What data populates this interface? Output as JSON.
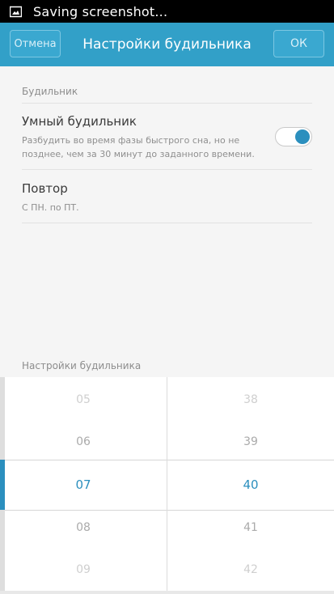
{
  "status_bar": {
    "icon": "image-icon",
    "text": "Saving screenshot..."
  },
  "title_bar": {
    "cancel_label": "Отмена",
    "title": "Настройки будильника",
    "ok_label": "ОК",
    "accent_color": "#32a0c8"
  },
  "settings": {
    "section_header": "Будильник",
    "smart_alarm": {
      "title": "Умный будильник",
      "description": "Разбудить во время фазы быстрого сна, но не позднее, чем за 30 минут до заданного времени.",
      "enabled": true
    },
    "repeat": {
      "title": "Повтор",
      "value": "С ПН. по ПТ."
    }
  },
  "picker": {
    "label": "Настройки будильника",
    "hours": [
      "05",
      "06",
      "07",
      "08",
      "09"
    ],
    "minutes": [
      "38",
      "39",
      "40",
      "41",
      "42"
    ],
    "selected_hour": "07",
    "selected_minute": "40",
    "selection_color": "#2b8fbe"
  }
}
